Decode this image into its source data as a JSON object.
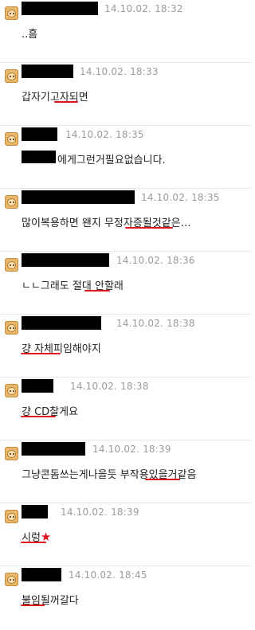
{
  "comments": [
    {
      "timestamp": "14.10.02. 18:32",
      "text": "..흠"
    },
    {
      "timestamp": "14.10.02. 18:33",
      "text": "갑자기고자되면"
    },
    {
      "timestamp": "14.10.02. 18:35",
      "text": "에게그런거필요없습니다."
    },
    {
      "timestamp": "14.10.02. 18:35",
      "text": "많이복용하면 왠지 무정자증될것같은…"
    },
    {
      "timestamp": "14.10.02. 18:36",
      "text": "ㄴㄴ그래도 절대 안할래"
    },
    {
      "timestamp": "14.10.02. 18:38",
      "text": "걍 자체피임해야지"
    },
    {
      "timestamp": "14.10.02. 18:38",
      "text": "걍 CD찰게요"
    },
    {
      "timestamp": "14.10.02. 18:39",
      "text": "그냥콘돔쓰는게나을듯 부작용있을거같음"
    },
    {
      "timestamp": "14.10.02. 18:39",
      "text": "시렁",
      "star": "★"
    },
    {
      "timestamp": "14.10.02. 18:45",
      "text": "불임될꺼갈다"
    }
  ],
  "colors": {
    "underline": "#e0121b",
    "timestamp": "#9b9b9b",
    "redaction": "#000000"
  }
}
